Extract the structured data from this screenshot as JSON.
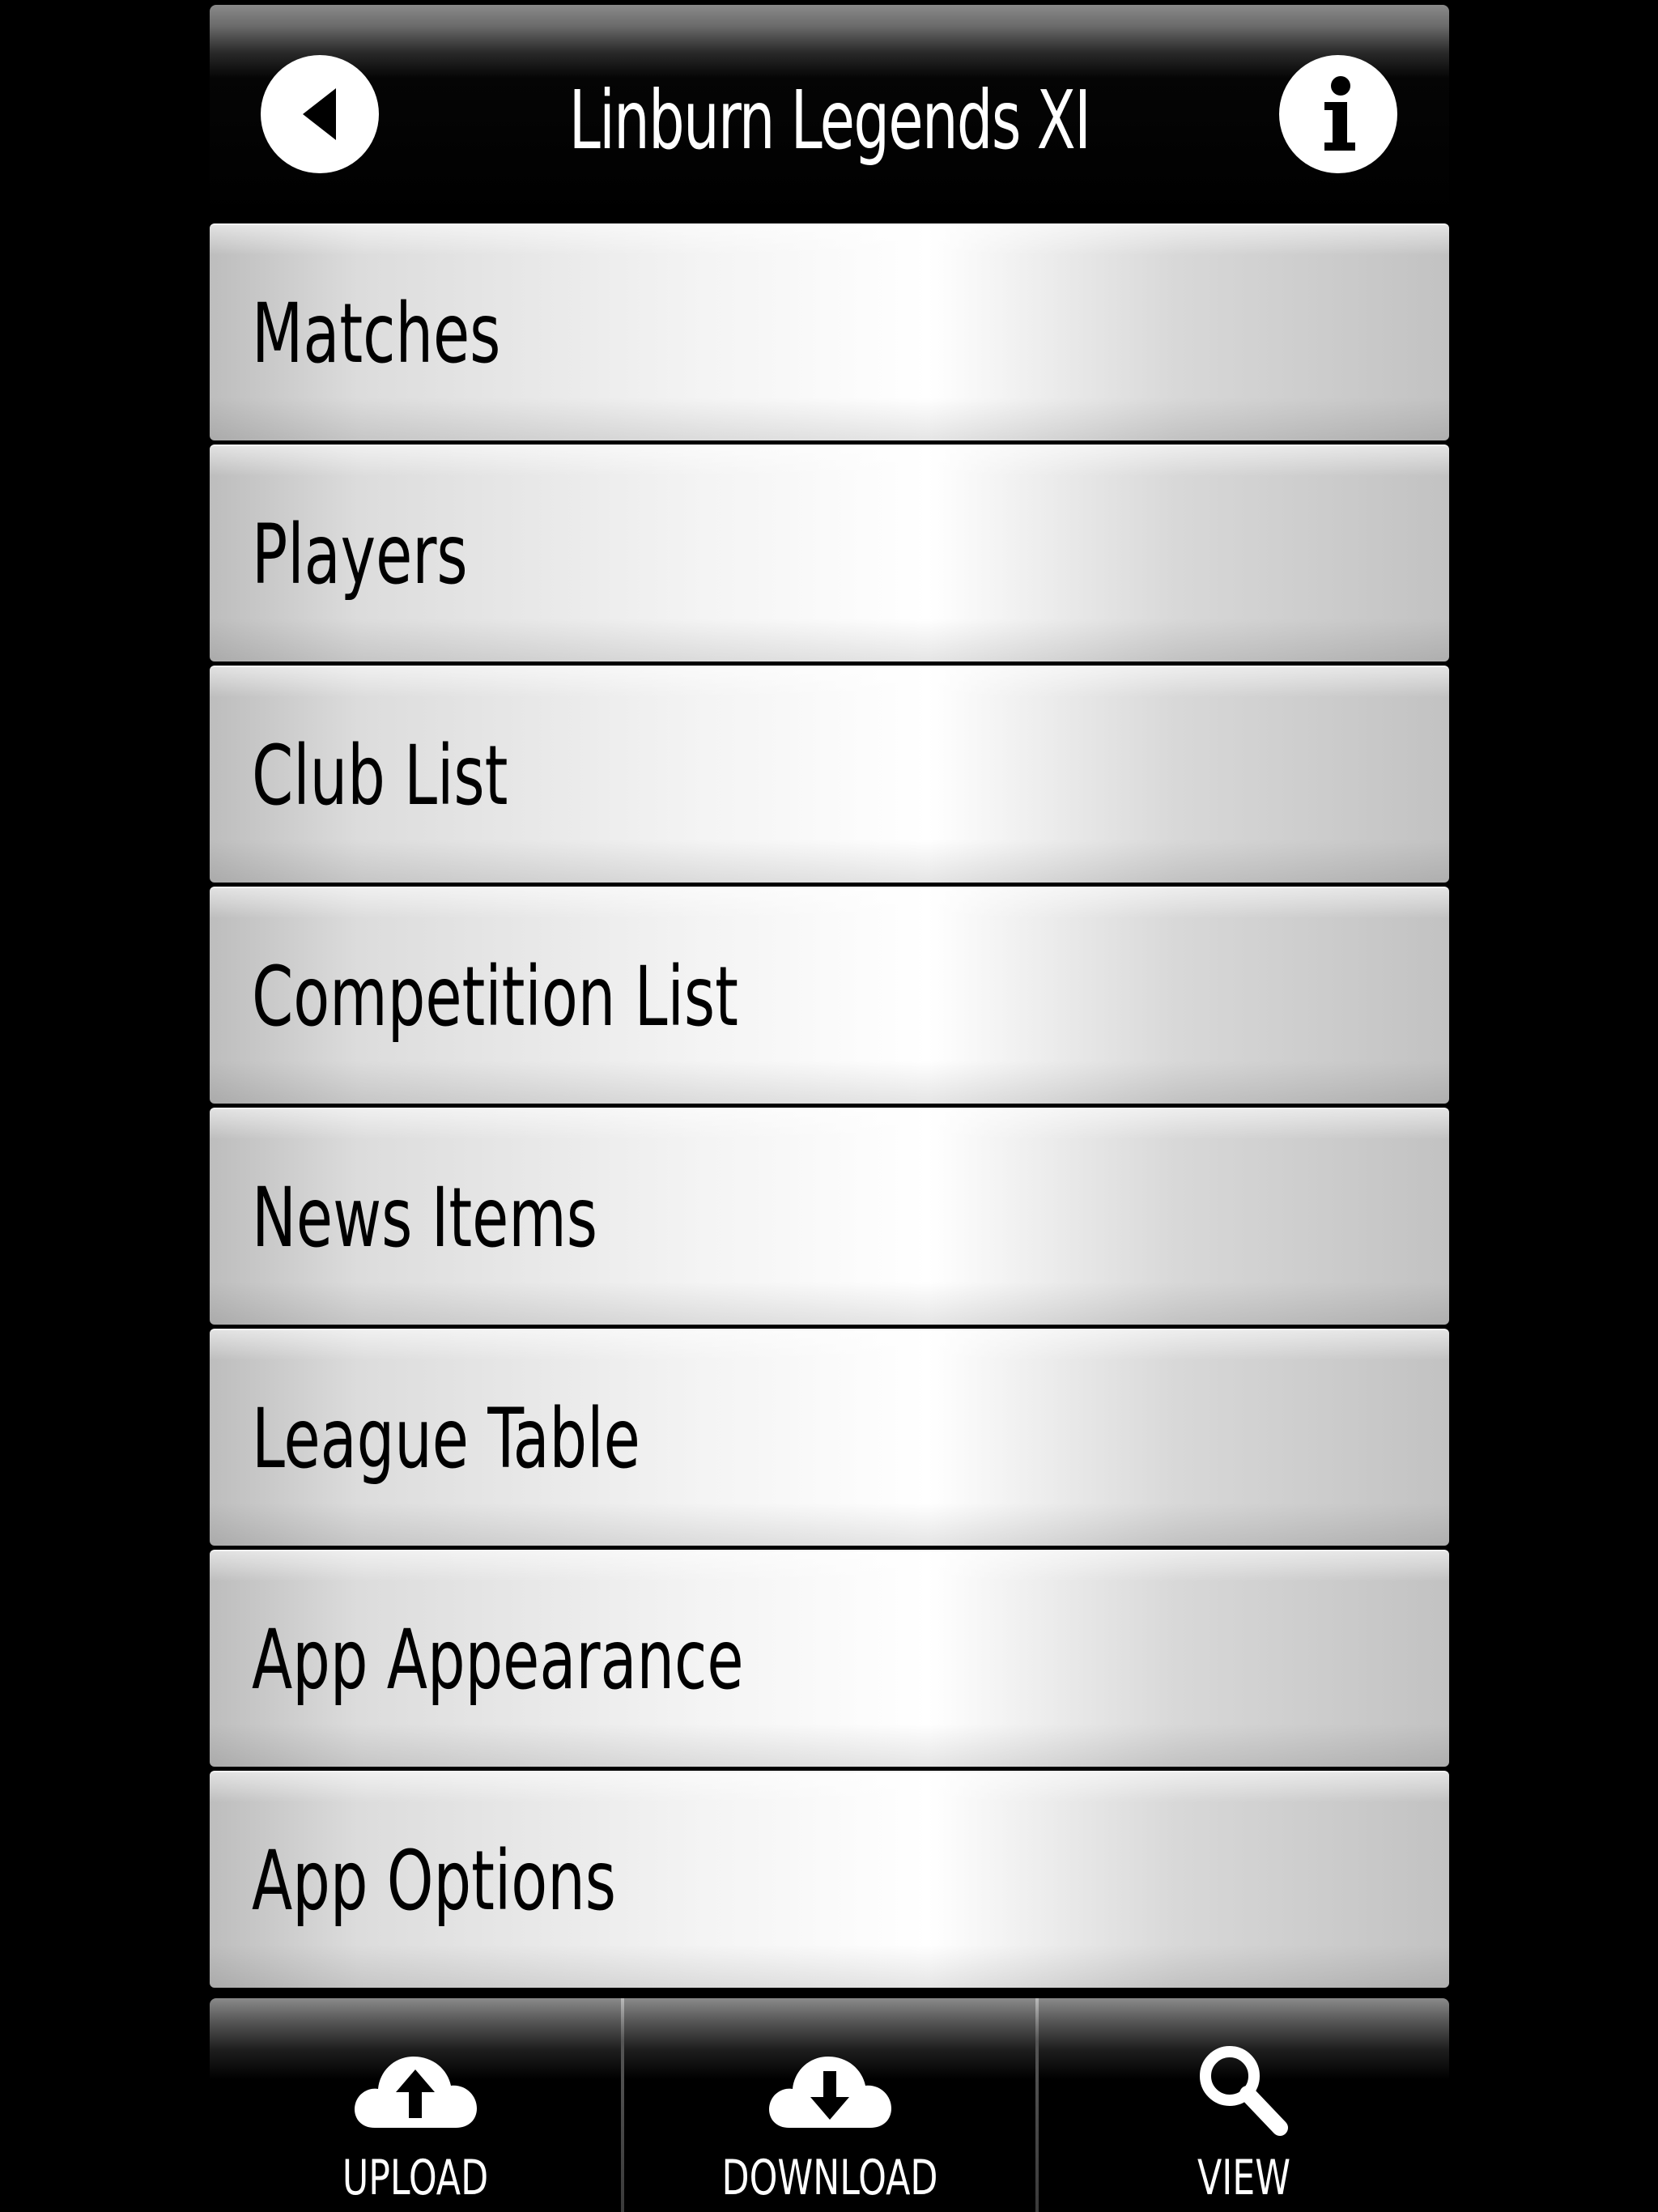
{
  "header": {
    "title": "Linburn Legends XI",
    "back_icon": "back-arrow-icon",
    "info_icon": "info-icon"
  },
  "menu": {
    "items": [
      {
        "label": "Matches"
      },
      {
        "label": "Players"
      },
      {
        "label": "Club List"
      },
      {
        "label": "Competition List"
      },
      {
        "label": "News Items"
      },
      {
        "label": "League Table"
      },
      {
        "label": "App Appearance"
      },
      {
        "label": "App Options"
      }
    ]
  },
  "bottom_bar": {
    "tabs": [
      {
        "label": "UPLOAD",
        "icon": "cloud-upload-icon"
      },
      {
        "label": "DOWNLOAD",
        "icon": "cloud-download-icon"
      },
      {
        "label": "VIEW",
        "icon": "magnifier-icon"
      }
    ]
  },
  "colors": {
    "background": "#000000",
    "menu_text": "#000000",
    "header_text": "#ffffff"
  }
}
